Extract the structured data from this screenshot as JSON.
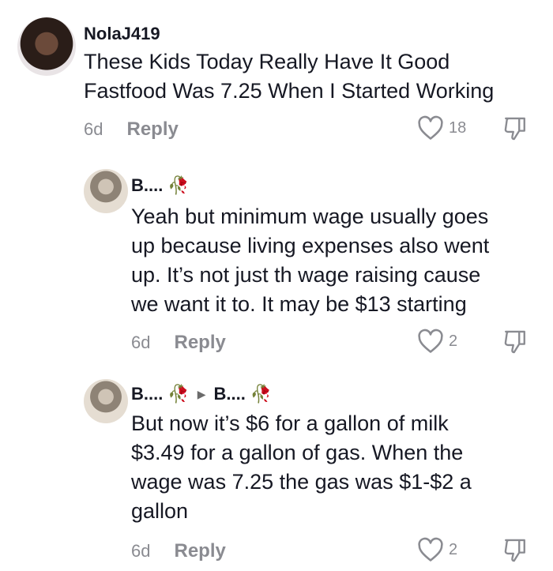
{
  "comments": [
    {
      "username": "NolaJ419",
      "text": "These Kids Today Really Have It Good\nFastfood Was 7.25 When I Started Working",
      "age": "6d",
      "reply_label": "Reply",
      "likes": "18"
    },
    {
      "username": "B....",
      "user_emoji": "🥀",
      "text": "Yeah but minimum wage usually goes\nup because living expenses also went\nup. It’s not just th wage raising cause\nwe want it to. It may be $13 starting",
      "age": "6d",
      "reply_label": "Reply",
      "likes": "2"
    },
    {
      "username": "B....",
      "user_emoji": "🥀",
      "reply_to": "B....",
      "reply_to_emoji": "🥀",
      "text": "But now it’s $6 for a gallon of milk\n$3.49 for a gallon of gas. When the\nwage was 7.25 the gas was $1-$2 a\ngallon",
      "age": "6d",
      "reply_label": "Reply",
      "likes": "2"
    }
  ],
  "icons": {
    "like": "heart-outline-icon",
    "dislike": "thumbs-down-outline-icon",
    "reply_arrow": "triangle-right-icon"
  },
  "colors": {
    "text": "#161823",
    "muted": "#8a8b91"
  }
}
